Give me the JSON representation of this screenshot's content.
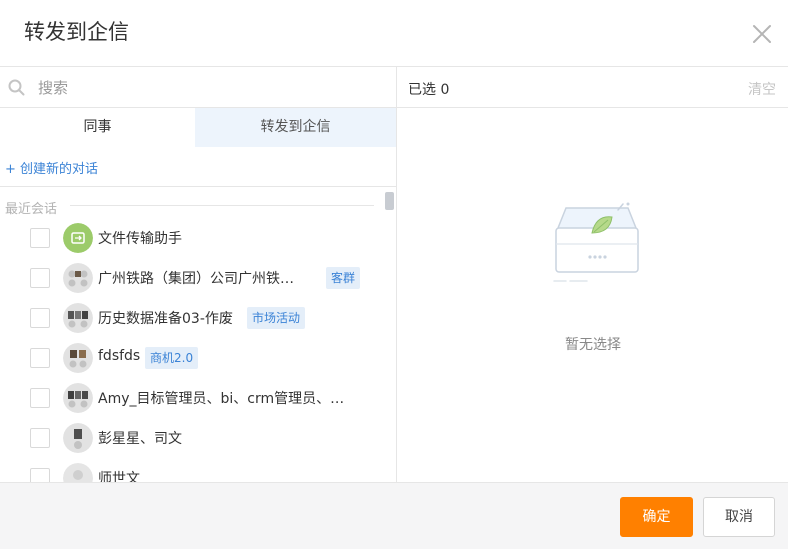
{
  "dialog": {
    "title": "转发到企信"
  },
  "search": {
    "placeholder": "搜索",
    "value": ""
  },
  "tabs": [
    {
      "label": "同事",
      "active": true
    },
    {
      "label": "转发到企信",
      "active": false
    }
  ],
  "create_link": "+ 创建新的对话",
  "recent_label": "最近会话",
  "conversations": [
    {
      "name": "文件传输助手",
      "tag": "",
      "avatar": "folder-transfer-icon"
    },
    {
      "name": "广州铁路（集团）公司广州铁…",
      "tag": "客群",
      "avatar": "group-avatar"
    },
    {
      "name": "历史数据准备03-作废",
      "tag": "市场活动",
      "avatar": "group-avatar"
    },
    {
      "name": "fdsfds",
      "tag": "商机2.0",
      "avatar": "group-avatar"
    },
    {
      "name": "Amy_目标管理员、bi、crm管理员、…",
      "tag": "",
      "avatar": "group-avatar"
    },
    {
      "name": "彭星星、司文",
      "tag": "",
      "avatar": "group-avatar"
    },
    {
      "name": "师世文",
      "tag": "",
      "avatar": "person-avatar"
    }
  ],
  "selection": {
    "label": "已选 0",
    "clear_label": "清空",
    "empty_text": "暂无选择"
  },
  "footer": {
    "confirm_label": "确定",
    "cancel_label": "取消"
  },
  "colors": {
    "accent": "#ff8000",
    "link": "#3b83d6",
    "tab_inactive_bg": "#edf4fc",
    "tag_bg": "#e4eef9"
  }
}
